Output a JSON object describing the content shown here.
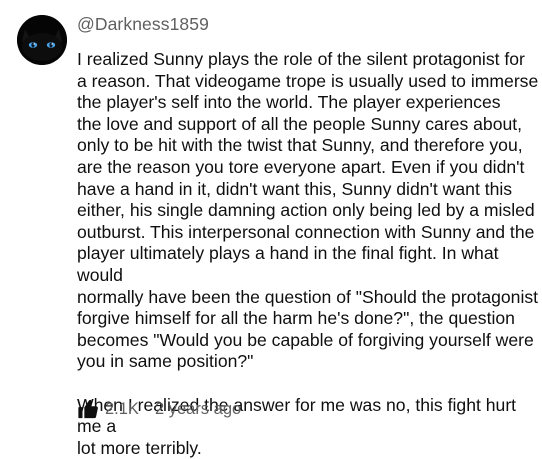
{
  "comment": {
    "author": "@Darkness1859",
    "avatar_icon": "black-cat-icon",
    "paragraphs": [
      "I realized Sunny plays the role of the silent protagonist for\na reason. That videogame trope is usually used to immerse\nthe player's self into the world. The player experiences\nthe love and support of all the people Sunny cares about,\nonly to be hit with the twist that Sunny, and therefore you,\nare the reason you tore everyone apart. Even if you didn't\nhave a hand in it, didn't want this, Sunny didn't want this\neither, his single damning action only being led by a misled\noutburst. This interpersonal connection with Sunny and the\nplayer ultimately plays a hand in the final fight. In what would\nnormally have been the question of \"Should the protagonist\nforgive himself for all the harm he's done?\", the question\nbecomes \"Would you be capable of forgiving yourself were\nyou in same position?\"",
      "When I realized the answer for me was no, this fight hurt me a\nlot more terribly."
    ],
    "likes": "2.1K",
    "like_icon": "thumbs-up-icon",
    "timestamp": "2 years ago"
  },
  "colors": {
    "text_primary": "#0f0f0f",
    "text_secondary": "#606060",
    "background": "#ffffff",
    "cat_eyes": "#4aa3e8"
  }
}
